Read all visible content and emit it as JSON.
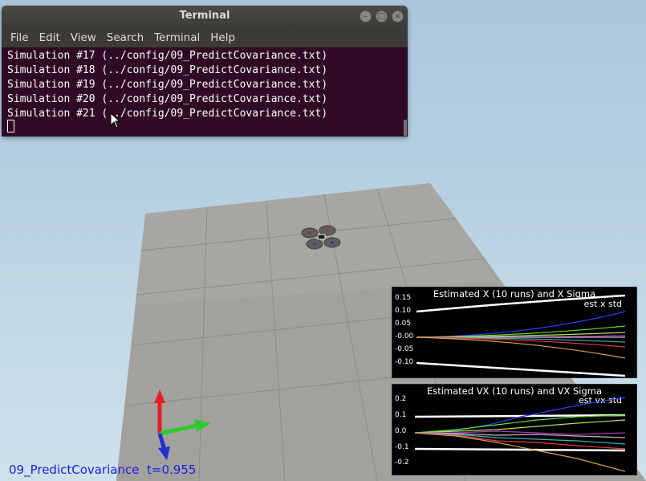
{
  "terminal": {
    "title": "Terminal",
    "menu": [
      "File",
      "Edit",
      "View",
      "Search",
      "Terminal",
      "Help"
    ],
    "lines": [
      "Simulation #17 (../config/09_PredictCovariance.txt)",
      "Simulation #18 (../config/09_PredictCovariance.txt)",
      "Simulation #19 (../config/09_PredictCovariance.txt)",
      "Simulation #20 (../config/09_PredictCovariance.txt)",
      "Simulation #21 (../config/09_PredictCovariance.txt)"
    ]
  },
  "plots": [
    {
      "title": "Estimated X (10 runs) and X Sigma",
      "legend": "est x std",
      "yticks": [
        "0.15",
        "0.10",
        "0.05",
        "-0.00",
        "-0.05",
        "-0.10"
      ]
    },
    {
      "title": "Estimated VX (10 runs) and VX Sigma",
      "legend": "est vx std",
      "yticks": [
        "0.2",
        "0.1",
        "0.0",
        "-0.1",
        "-0.2"
      ]
    }
  ],
  "status": {
    "config": "09_PredictCovariance",
    "time": "t=0.955"
  },
  "colors": {
    "terminal_bg": "#300a24",
    "status_text": "#1a23d9",
    "axis_x": "#2fc82f",
    "axis_y": "#e02020",
    "axis_z": "#2030d0"
  }
}
